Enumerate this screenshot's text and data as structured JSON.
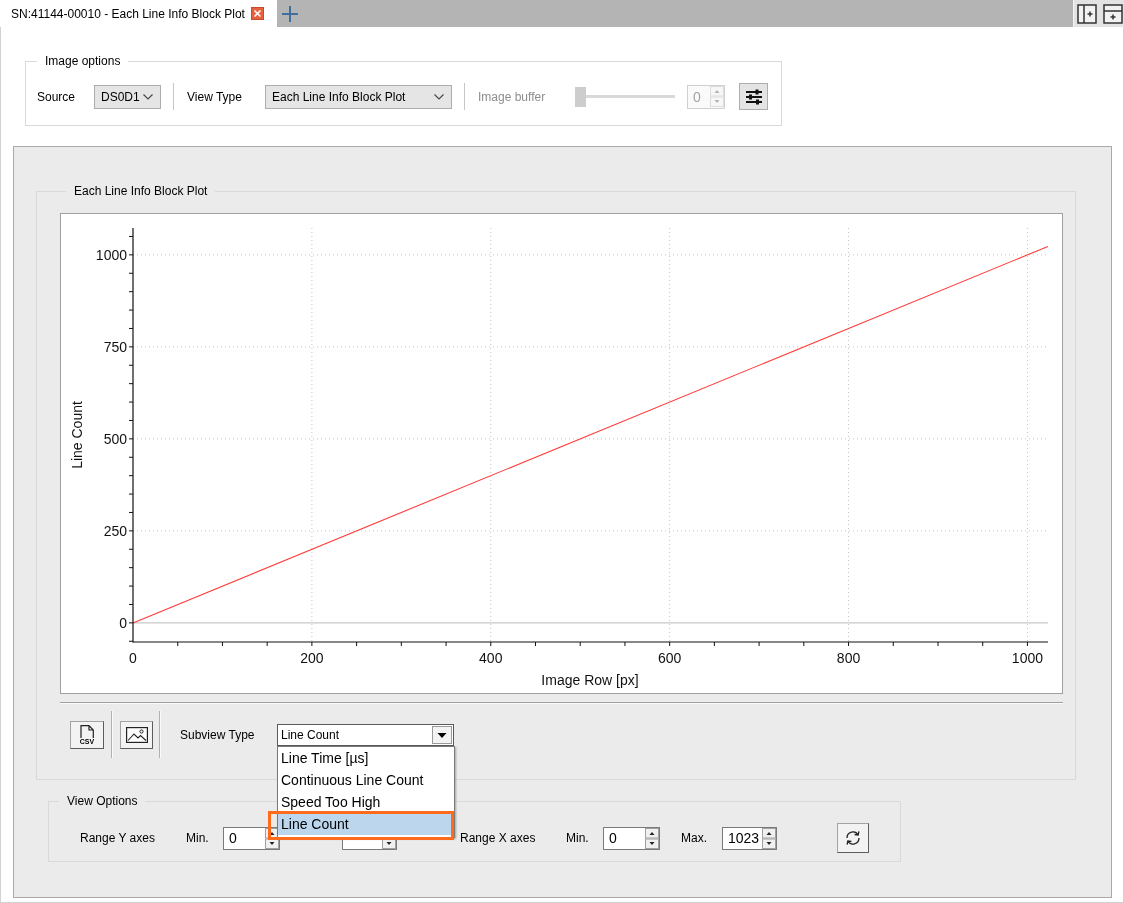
{
  "tabs": [
    {
      "label": "SN:41144-00010 - Each Line Info Block Plot",
      "selected": true
    }
  ],
  "image_options": {
    "title": "Image options",
    "source": {
      "label": "Source",
      "value": "DS0D1"
    },
    "view_type": {
      "label": "View Type",
      "value": "Each Line Info Block Plot"
    },
    "image_buffer": {
      "label": "Image buffer",
      "disabled": true,
      "level": 0,
      "value": "0"
    }
  },
  "plot_group": {
    "title": "Each Line Info Block Plot",
    "chart_data": {
      "type": "line",
      "xlabel": "Image Row [px]",
      "ylabel": "Line Count",
      "x": [
        0,
        1023
      ],
      "series": [
        {
          "color": "#ff3b3b",
          "values": [
            0,
            1023
          ]
        }
      ],
      "xlim": [
        0,
        1023
      ],
      "ylim": [
        -52,
        1073
      ],
      "xticks": [
        0,
        200,
        400,
        600,
        800,
        1000
      ],
      "yticks": [
        0,
        250,
        500,
        750,
        1000
      ],
      "grid": true
    }
  },
  "toolbar": {
    "csv_button": {
      "label": "CSV"
    },
    "subview_type": {
      "label": "Subview Type",
      "value": "Line Count",
      "expanded": true,
      "options": [
        {
          "label": "Line Time [µs]",
          "selected": false,
          "highlighted": false
        },
        {
          "label": "Continuous Line Count",
          "selected": false,
          "highlighted": false
        },
        {
          "label": "Speed Too High",
          "selected": false,
          "highlighted": false
        },
        {
          "label": "Line Count",
          "selected": true,
          "highlighted": true
        }
      ]
    }
  },
  "view_options": {
    "title": "View Options",
    "ranges": [
      {
        "label": "Range Y axes",
        "min_label": "Min.",
        "min": "0"
      },
      {
        "label": "Range X axes",
        "min_label": "Min.",
        "min": "0",
        "max_label": "Max.",
        "max": "1023"
      }
    ]
  }
}
